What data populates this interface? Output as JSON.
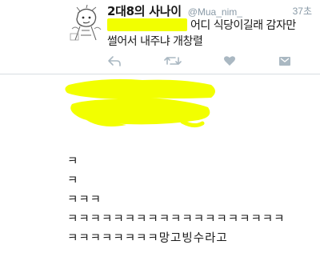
{
  "tweet": {
    "display_name": "2대8의 사나이",
    "handle": "@Mua_nim_",
    "timestamp": "37초",
    "body_line1": "어디 식당이길래 감자만",
    "body_line2": "썰어서 내주냐 개창렬",
    "icons": [
      "reply-icon",
      "retweet-icon",
      "like-icon",
      "message-icon"
    ]
  },
  "reply": {
    "lines": [
      "ㅋ",
      "ㅋ",
      "ㅋㅋㅋ",
      "ㅋㅋㅋㅋㅋㅋㅋㅋㅋㅋㅋㅋㅋㅋㅋㅋㅋㅋㅋ",
      "ㅋㅋㅋㅋㅋㅋㅋㅋ망고빙수라고"
    ]
  },
  "colors": {
    "redaction": "#f2ff00",
    "text": "#1a1a1a",
    "meta": "#8899a6"
  }
}
